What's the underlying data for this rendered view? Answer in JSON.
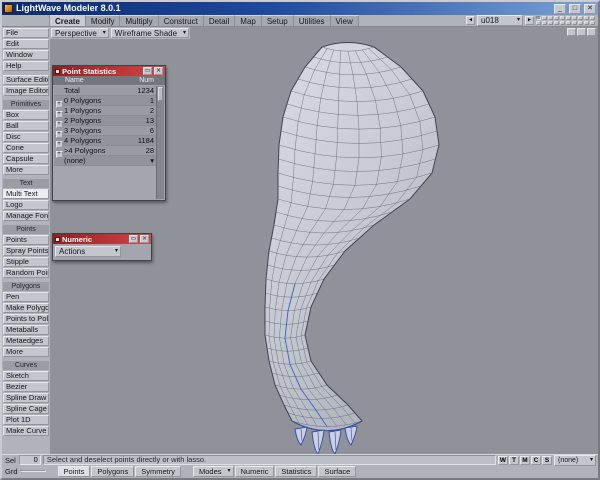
{
  "titlebar": {
    "title": "LightWave Modeler 8.0.1",
    "minimize": "_",
    "maximize": "□",
    "close": "✕"
  },
  "menubar": {
    "tabs": [
      "Create",
      "Modify",
      "Multiply",
      "Construct",
      "Detail",
      "Map",
      "Setup",
      "Utilities",
      "View"
    ],
    "active_tab": "Create",
    "prev_arrow": "◄",
    "next_arrow": "►",
    "object_selector": "u018"
  },
  "viewport_toolbar": {
    "view_mode": "Perspective",
    "shade_mode": "Wireframe Shade"
  },
  "sidebar": {
    "top_items": [
      "File",
      "Edit",
      "Window",
      "Help"
    ],
    "editor_items": [
      "Surface Editor",
      "Image Editor"
    ],
    "selected_item": "Multi Text",
    "sections": [
      {
        "label": "Primitives",
        "items": [
          "Box",
          "Ball",
          "Disc",
          "Cone",
          "Capsule",
          "More"
        ]
      },
      {
        "label": "Text",
        "items": [
          "Multi Text",
          "Logo",
          "Manage Fonts"
        ]
      },
      {
        "label": "Points",
        "items": [
          "Points",
          "Spray Points",
          "Stipple",
          "Random Points"
        ]
      },
      {
        "label": "Polygons",
        "items": [
          "Pen",
          "Make Polygon",
          "Points to Polys",
          "Metaballs",
          "Metaedges",
          "More"
        ]
      },
      {
        "label": "Curves",
        "items": [
          "Sketch",
          "Bezier",
          "Spline Draw",
          "Spline Cage",
          "Plot 1D",
          "Make Curve"
        ]
      }
    ]
  },
  "stats_panel": {
    "title": "Point Statistics",
    "col_name": "Name",
    "col_num": "Num",
    "minimize": "▭",
    "close": "✕",
    "rows": [
      {
        "sign": "",
        "name": "Total",
        "num": "1234"
      },
      {
        "sign": "+",
        "name": "0 Polygons",
        "num": "1"
      },
      {
        "sign": "+",
        "name": "1 Polygons",
        "num": "2"
      },
      {
        "sign": "+",
        "name": "2 Polygons",
        "num": "13"
      },
      {
        "sign": "+",
        "name": "3 Polygons",
        "num": "6"
      },
      {
        "sign": "+",
        "name": "4 Polygons",
        "num": "1184"
      },
      {
        "sign": "+",
        "name": ">4 Polygons",
        "num": "28"
      },
      {
        "sign": "",
        "name": "(none)",
        "num": "▾"
      }
    ]
  },
  "numeric_panel": {
    "title": "Numeric",
    "actions_dropdown": "Actions",
    "minimize": "▭",
    "close": "✕"
  },
  "status_bar": {
    "sel_label": "Sel",
    "sel_value": "0",
    "hint": "Select and deselect points directly or with lasso.",
    "vmap_buttons": [
      "W",
      "T",
      "M",
      "C",
      "S"
    ],
    "vmap_selected": "(none)"
  },
  "bottom_bar": {
    "grid_label": "Grd",
    "grid_value": "",
    "mode_buttons": [
      "Points",
      "Polygons",
      "Symmetry"
    ],
    "tool_buttons": [
      "Modes",
      "Numeric",
      "Statistics",
      "Surface"
    ]
  },
  "colors": {
    "panel_title": "#b02a2a",
    "titlebar_blue": "#1e4a9e",
    "selected_wire_blue": "#3b55c6",
    "viewport_gray": "#8f9298"
  }
}
